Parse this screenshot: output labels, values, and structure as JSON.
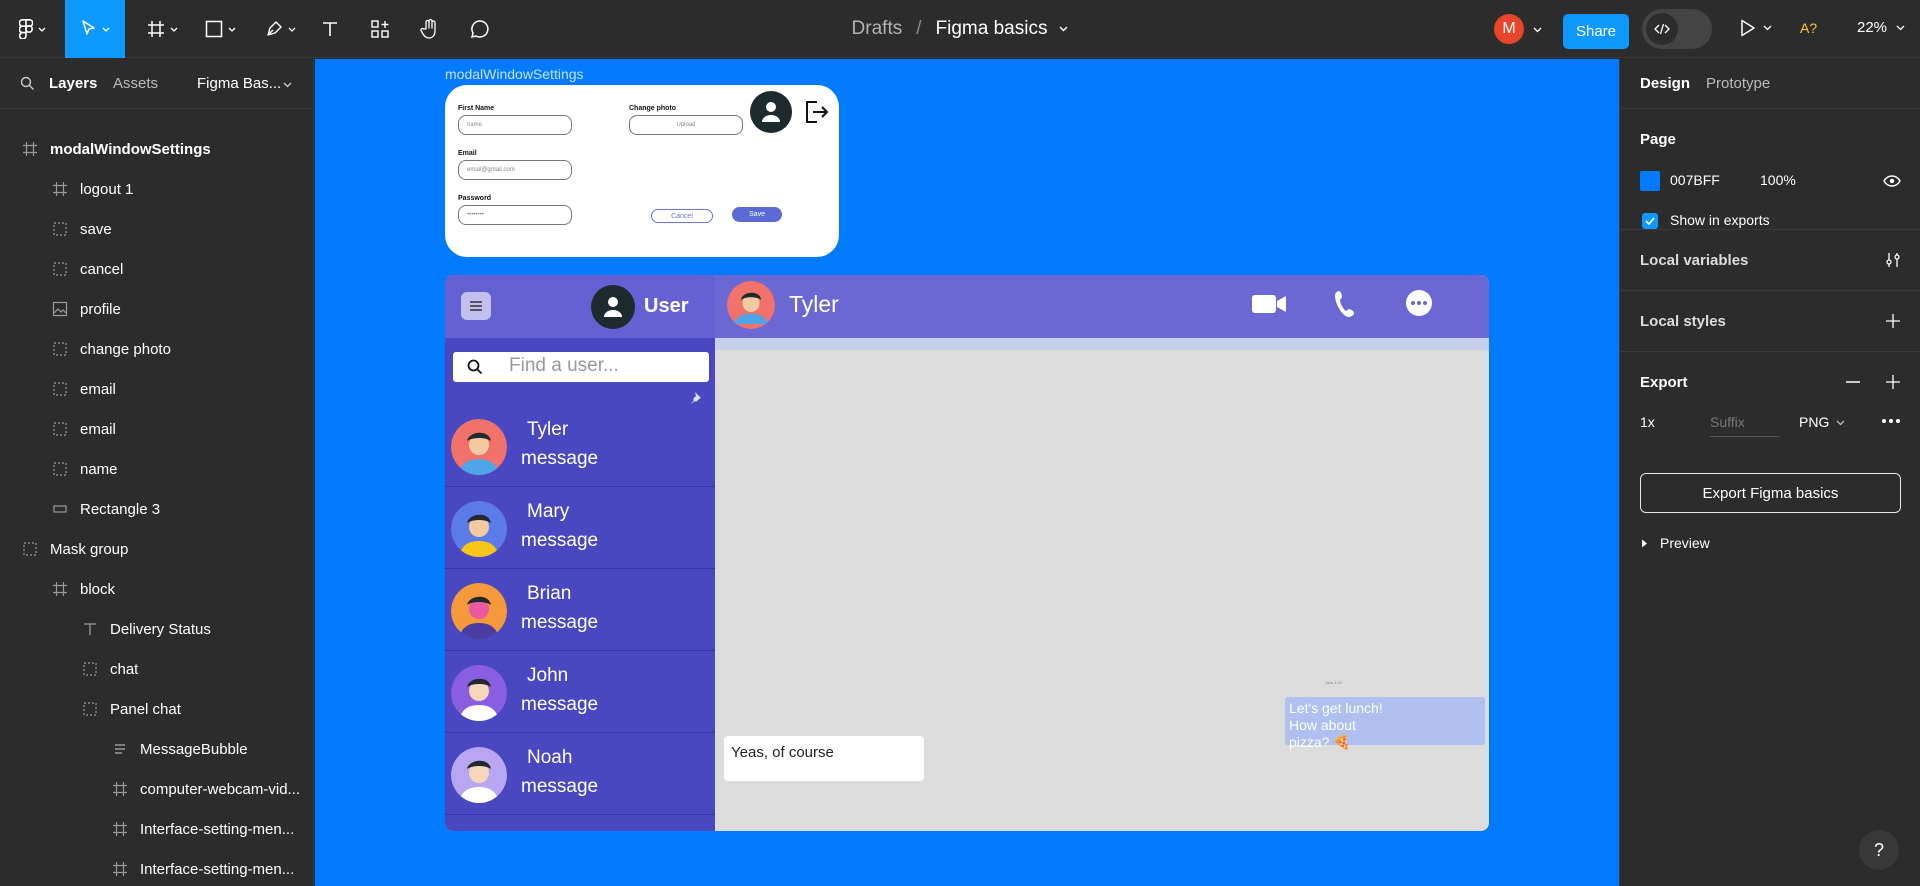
{
  "toolbar": {
    "breadcrumb_drafts": "Drafts",
    "breadcrumb_sep": "/",
    "file_name": "Figma basics",
    "avatar_initial": "M",
    "share_label": "Share",
    "a11y_label": "A?",
    "zoom_label": "22%",
    "accent": "#0d99ff"
  },
  "left_panel": {
    "tabs": [
      "Layers",
      "Assets"
    ],
    "page_selector": "Figma Bas...",
    "layers": [
      {
        "label": "modalWindowSettings",
        "icon": "frame-icon",
        "selected": true
      },
      {
        "label": "logout 1",
        "icon": "frame-icon"
      },
      {
        "label": "save",
        "icon": "group-icon"
      },
      {
        "label": "cancel",
        "icon": "group-icon"
      },
      {
        "label": "profile",
        "icon": "image-icon"
      },
      {
        "label": "change photo",
        "icon": "group-icon"
      },
      {
        "label": "email",
        "icon": "group-icon"
      },
      {
        "label": "email",
        "icon": "group-icon"
      },
      {
        "label": "name",
        "icon": "group-icon"
      },
      {
        "label": "Rectangle 3",
        "icon": "rectangle-icon"
      },
      {
        "label": "Mask group",
        "icon": "group-icon"
      },
      {
        "label": "block",
        "icon": "frame-icon"
      },
      {
        "label": "Delivery Status",
        "icon": "text-icon"
      },
      {
        "label": "chat",
        "icon": "group-icon"
      },
      {
        "label": "Panel chat",
        "icon": "group-icon"
      },
      {
        "label": "MessageBubble",
        "icon": "autolayout-icon"
      },
      {
        "label": "computer-webcam-vid...",
        "icon": "frame-icon"
      },
      {
        "label": "Interface-setting-men...",
        "icon": "frame-icon"
      },
      {
        "label": "Interface-setting-men...",
        "icon": "frame-icon"
      }
    ]
  },
  "canvas": {
    "background": "#007BFF",
    "frame_label": "modalWindowSettings",
    "modal": {
      "first_name_label": "First Name",
      "first_name_placeholder": "name",
      "change_photo_label": "Change photo",
      "upload_label": "Upload",
      "email_label": "Email",
      "email_placeholder": "email@gmail.com",
      "password_label": "Password",
      "password_value": "••••••••",
      "cancel_label": "Cancel",
      "save_label": "Save"
    },
    "chat": {
      "user_label": "User",
      "search_placeholder": "Find a user...",
      "contacts": [
        {
          "name": "Tyler",
          "message": "message"
        },
        {
          "name": "Mary",
          "message": "message"
        },
        {
          "name": "Brian",
          "message": "message"
        },
        {
          "name": "John",
          "message": "message"
        },
        {
          "name": "Noah",
          "message": "message"
        }
      ],
      "active_contact": "Tyler",
      "incoming_message": "Yeas, of course",
      "outgoing_message_line1": "Let's get lunch!",
      "outgoing_message_line2": "How about",
      "outgoing_message_line3": "pizza? 🍕",
      "message_time": "New 1:20"
    }
  },
  "right_panel": {
    "tabs": [
      "Design",
      "Prototype"
    ],
    "page_heading": "Page",
    "page_color": "007BFF",
    "page_opacity": "100%",
    "show_in_exports": "Show in exports",
    "local_variables": "Local variables",
    "local_styles": "Local styles",
    "export_heading": "Export",
    "export_scale": "1x",
    "export_suffix_placeholder": "Suffix",
    "export_format": "PNG",
    "export_button": "Export Figma basics",
    "preview_label": "Preview"
  },
  "help_label": "?"
}
